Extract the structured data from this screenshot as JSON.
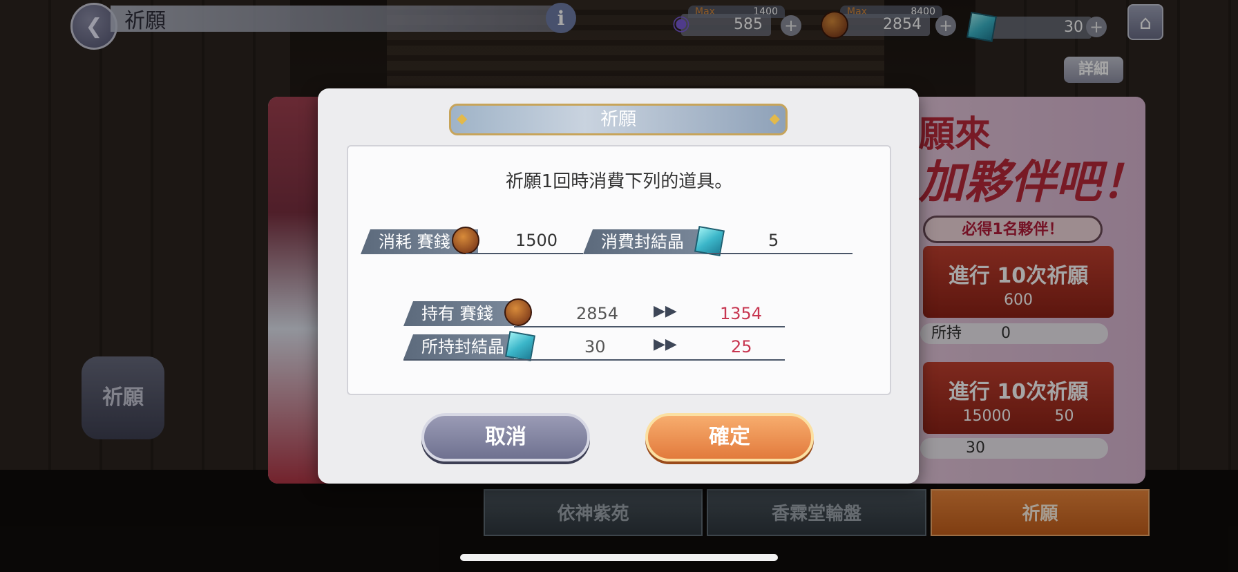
{
  "header": {
    "title": "祈願",
    "back_icon": "chevron-left-icon",
    "info_label": "i"
  },
  "resources": {
    "spirit": {
      "max_label": "Max",
      "max": "1400",
      "value": "585",
      "icon": "spirit-flame-icon"
    },
    "coin": {
      "max_label": "Max",
      "max": "8400",
      "value": "2854",
      "icon": "offering-coin-icon"
    },
    "crystal": {
      "value": "30",
      "icon": "seal-crystal-icon"
    },
    "plus_label": "+"
  },
  "detail_label": "詳細",
  "home_icon": "home-icon",
  "banner": {
    "headline1": "願來",
    "headline2": "加夥伴吧！",
    "must_badge": "必得1名夥伴！",
    "roll_a_title": "進行 10次祈願",
    "roll_a_cost": "600",
    "owned_label": "所持",
    "owned_value": "0",
    "roll_b_title": "進行 10次祈願",
    "roll_b_cost_coin": "15000",
    "roll_b_cost_crystal": "50",
    "crystal_owned": "30"
  },
  "side_button_label": "祈願",
  "tabs": [
    {
      "label": "依神紫苑",
      "active": false
    },
    {
      "label": "香霖堂輪盤",
      "active": false
    },
    {
      "label": "祈願",
      "active": true
    }
  ],
  "dialog": {
    "title": "祈願",
    "message": "祈願1回時消費下列的道具。",
    "cost_coin_label": "消耗  賽錢",
    "cost_coin_value": "1500",
    "cost_crystal_label": "消費封結晶",
    "cost_crystal_value": "5",
    "own_coin_label": "持有  賽錢",
    "own_coin_before": "2854",
    "own_coin_after": "1354",
    "own_crystal_label": "所持封結晶",
    "own_crystal_before": "30",
    "own_crystal_after": "25",
    "arrow": "▶▶",
    "cancel_label": "取消",
    "confirm_label": "確定"
  },
  "colors": {
    "accent_orange": "#e27a3c",
    "cancel_purple": "#7f8199",
    "after_value_red": "#c73550"
  }
}
